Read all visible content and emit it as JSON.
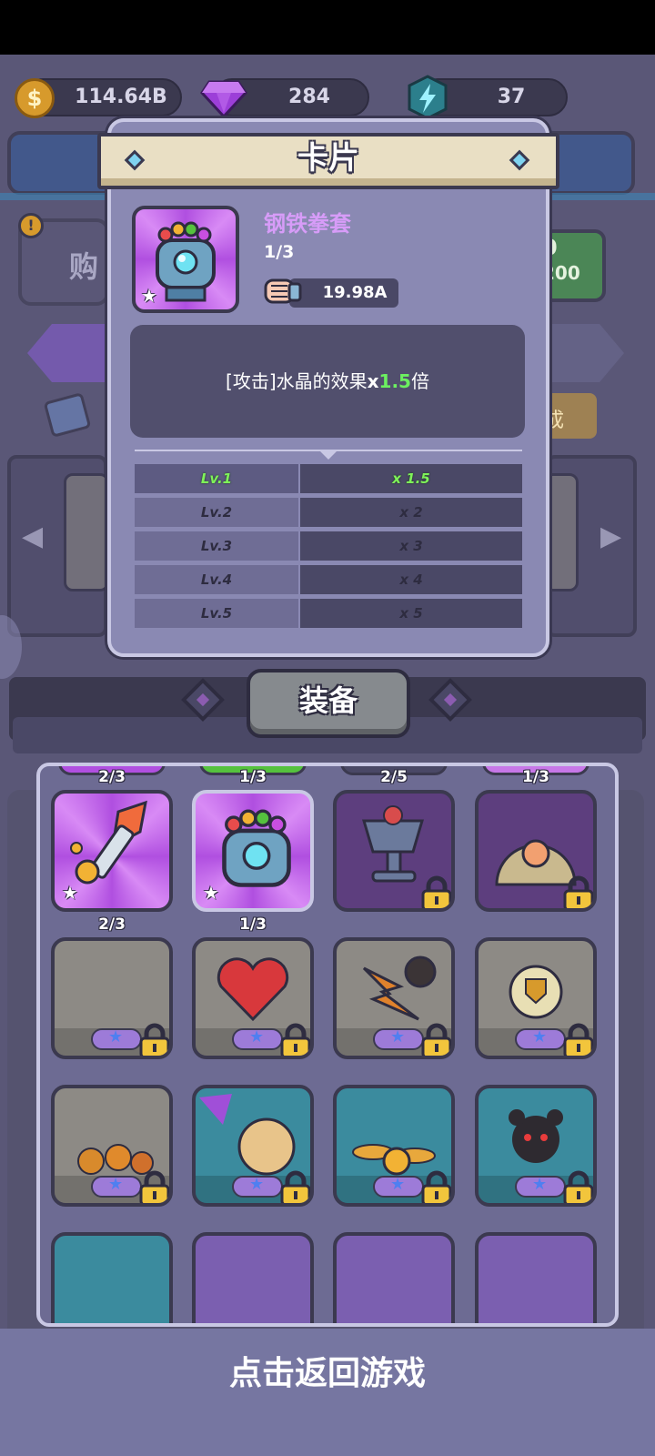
{
  "resources": {
    "coins": "114.64B",
    "gems": "284",
    "energy": "37"
  },
  "background": {
    "buy_label": "购",
    "price_top": "0",
    "price_bottom": "200",
    "merge_label": "成"
  },
  "modal": {
    "title": "卡片",
    "card_name": "钢铁拳套",
    "card_count": "1/3",
    "power_value": "19.98A",
    "description_prefix": "[攻击]水晶的效果",
    "description_x": "x",
    "description_mult": "1.5",
    "description_suffix": "倍",
    "levels": [
      {
        "level": "Lv.1",
        "value": "x 1.5",
        "active": true
      },
      {
        "level": "Lv.2",
        "value": "x 2",
        "active": false
      },
      {
        "level": "Lv.3",
        "value": "x 3",
        "active": false
      },
      {
        "level": "Lv.4",
        "value": "x 4",
        "active": false
      },
      {
        "level": "Lv.5",
        "value": "x 5",
        "active": false
      }
    ]
  },
  "equip_label": "装备",
  "grid": {
    "row0_counts": [
      "2/3",
      "1/3",
      "2/5",
      "1/3"
    ],
    "row1_counts": [
      "2/3",
      "1/3"
    ]
  },
  "back_to_game": "点击返回游戏"
}
